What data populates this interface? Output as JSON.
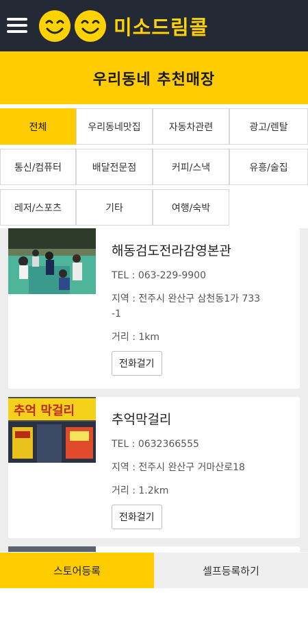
{
  "header": {
    "logo_text": "미소드림콜",
    "menu_icon": "hamburger-menu-icon",
    "logo_icon": "smiley-face-icon"
  },
  "banner": {
    "title": "우리동네 추천매장"
  },
  "categories": [
    [
      {
        "label": "전체",
        "active": true
      },
      {
        "label": "우리동네맛집",
        "active": false
      },
      {
        "label": "자동차관련",
        "active": false
      },
      {
        "label": "광고/렌탈",
        "active": false
      }
    ],
    [
      {
        "label": "통신/컴퓨터",
        "active": false
      },
      {
        "label": "배달전문점",
        "active": false
      },
      {
        "label": "커피/스낵",
        "active": false
      },
      {
        "label": "유흥/술집",
        "active": false
      }
    ],
    [
      {
        "label": "레저/스포츠",
        "active": false
      },
      {
        "label": "기타",
        "active": false
      },
      {
        "label": "여행/숙박",
        "active": false
      }
    ]
  ],
  "stores": [
    {
      "name": "해동검도전라감영본관",
      "tel": "TEL : 063-229-9900",
      "region_line1": "지역 : 전주시 완산구 삼천동1가 733",
      "region_line2": "-1",
      "distance": "거리 : 1km",
      "call_label": "전화걸기"
    },
    {
      "name": "추억막걸리",
      "tel": "TEL : 0632366555",
      "region_line1": "지역 : 전주시 완산구 거마산로18",
      "region_line2": "",
      "distance": "거리 : 1.2km",
      "call_label": "전화걸기"
    }
  ],
  "bottom_bar": {
    "store_register_label": "스토어등록",
    "self_register_label": "셀프등록하기"
  },
  "colors": {
    "accent": "#ffcc00",
    "topbar": "#232a36"
  }
}
